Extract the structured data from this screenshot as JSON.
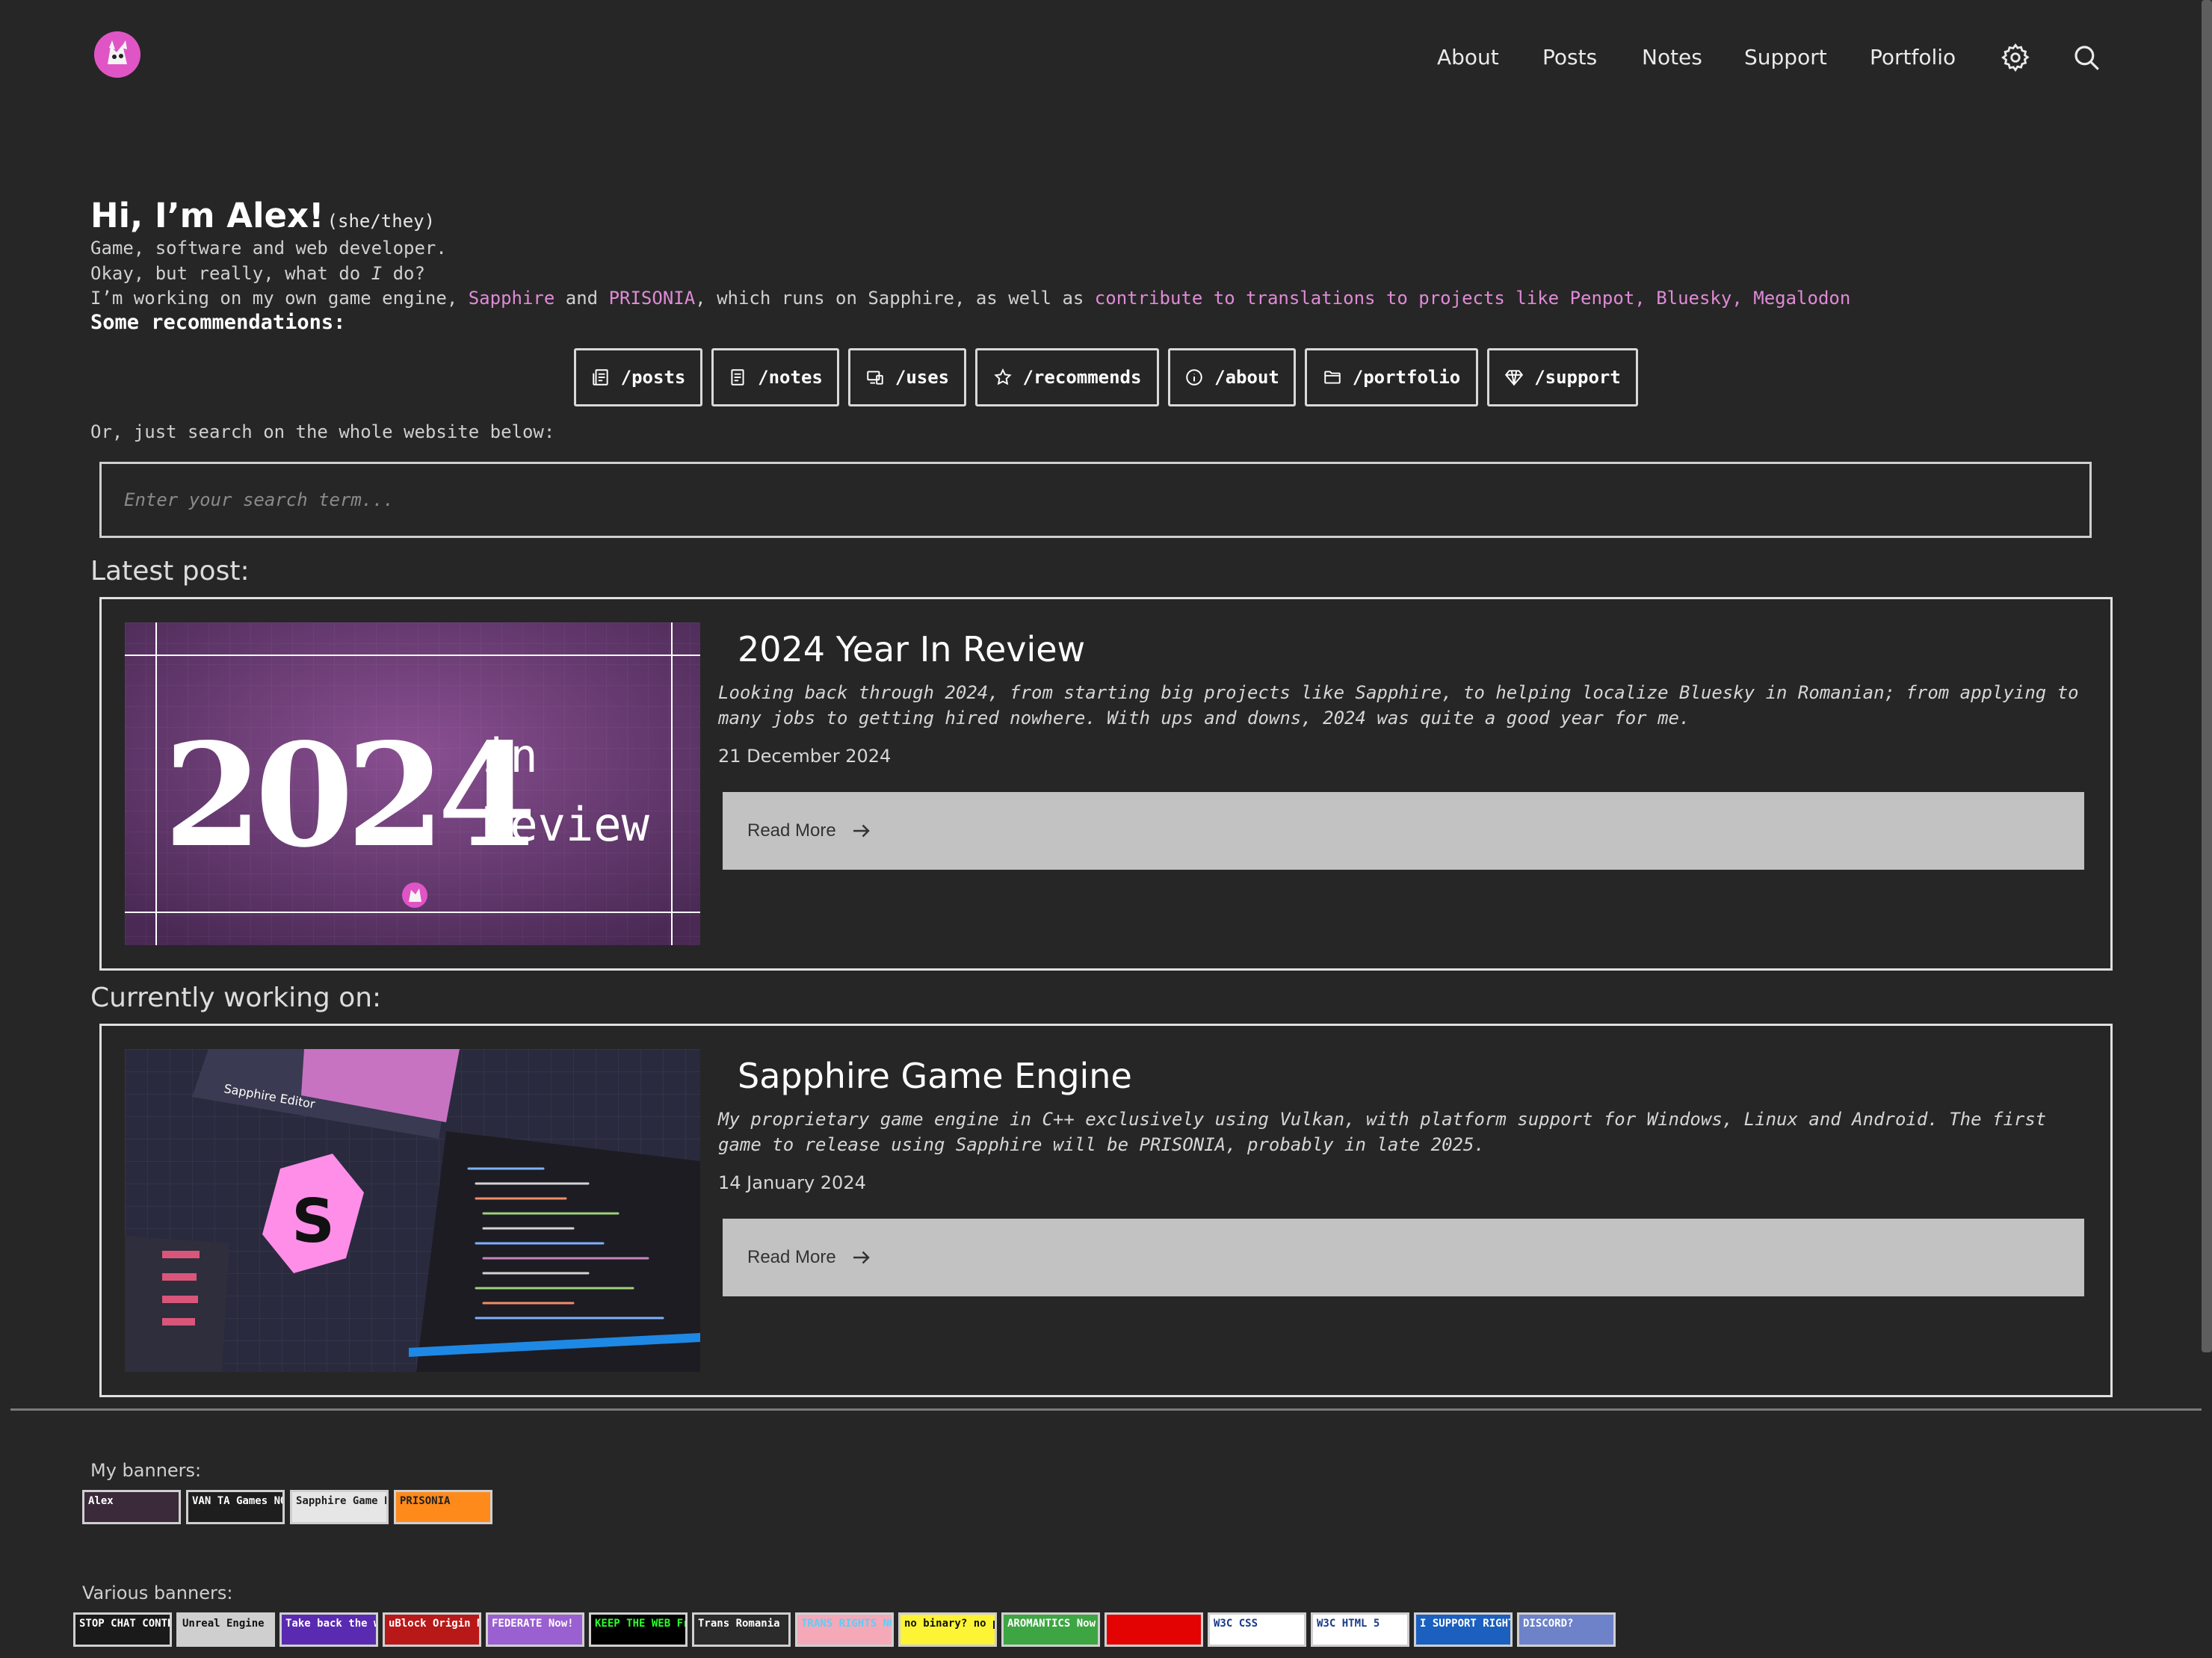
{
  "nav": {
    "links": [
      "About",
      "Posts",
      "Notes",
      "Support",
      "Portfolio"
    ],
    "settings_icon": "gear-icon",
    "search_icon": "search-icon"
  },
  "hero": {
    "greeting": "Hi, I’m Alex!",
    "pronouns": "(she/they)",
    "line1": "Game, software and web developer.",
    "line2_a": "Okay, but really, what do ",
    "line2_b": "I",
    "line2_c": " do?",
    "line3_a": "I’m working on my own game engine, ",
    "line3_sapphire": "Sapphire",
    "line3_and": " and ",
    "line3_prisonia": "PRISONIA",
    "line3_b": ", which runs on Sapphire, as well as ",
    "line3_contribute": "contribute to translations to projects like",
    "line3_penpot": "Penpot",
    "line3_bluesky": "Bluesky",
    "line3_megalodon": "Megalodon",
    "sep": ", ",
    "space": " ",
    "recommendations_label": "Some recommendations:"
  },
  "recommendations": [
    {
      "label": "/posts",
      "icon": "posts-icon"
    },
    {
      "label": "/notes",
      "icon": "notes-icon"
    },
    {
      "label": "/uses",
      "icon": "devices-icon"
    },
    {
      "label": "/recommends",
      "icon": "star-icon"
    },
    {
      "label": "/about",
      "icon": "info-icon"
    },
    {
      "label": "/portfolio",
      "icon": "folder-icon"
    },
    {
      "label": "/support",
      "icon": "diamond-icon"
    }
  ],
  "search": {
    "prompt": "Or, just search on the whole website below:",
    "placeholder": "Enter your search term..."
  },
  "latest_post": {
    "heading": "Latest post:",
    "title": "2024 Year In Review",
    "description": "Looking back through 2024, from starting big projects like Sapphire, to helping localize Bluesky in Romanian; from applying to many jobs to getting hired nowhere. With ups and downs, 2024 was quite a good year for me.",
    "date": "21 December 2024",
    "read_more": "Read More",
    "image_text_year": "2024",
    "image_text_in": "in",
    "image_text_review": "Review"
  },
  "current_project": {
    "heading": "Currently working on:",
    "title": "Sapphire Game Engine",
    "description": "My proprietary game engine in C++ exclusively using Vulkan, with platform support for Windows, Linux and Android. The first game to release using Sapphire will be PRISONIA, probably in late 2025.",
    "date": "14 January 2024",
    "read_more": "Read More",
    "image_editor_label": "Sapphire Editor",
    "image_logo_letter": "S"
  },
  "footer": {
    "my_banners_label": "My banners:",
    "my_banners": [
      {
        "text": "Alex",
        "bg": "#3a2a3a",
        "fg": "#ffffff"
      },
      {
        "text": "VAN TA  Games NOW!",
        "bg": "#1e1e1e",
        "fg": "#ffffff"
      },
      {
        "text": "Sapphire Game Engine",
        "bg": "#e6e6e6",
        "fg": "#222222"
      },
      {
        "text": "PRISONIA",
        "bg": "#ff8a1c",
        "fg": "#222222"
      }
    ],
    "various_banners_label": "Various banners:",
    "various_banners": [
      {
        "text": "STOP CHAT CONTROL",
        "bg": "#1a1a1a",
        "fg": "#ffffff"
      },
      {
        "text": "Unreal Engine",
        "bg": "#cfcfcf",
        "fg": "#111111"
      },
      {
        "text": "Take back the web",
        "bg": "#5a2bb0",
        "fg": "#ffffff"
      },
      {
        "text": "uBlock Origin Now!",
        "bg": "#b81818",
        "fg": "#ffffff"
      },
      {
        "text": "FEDERATE Now!",
        "bg": "#9a5fd0",
        "fg": "#ffffff"
      },
      {
        "text": "KEEP THE WEB Free",
        "bg": "#000000",
        "fg": "#2bff2b"
      },
      {
        "text": "Trans Romania",
        "bg": "#2b2b2b",
        "fg": "#ffffff"
      },
      {
        "text": "TRANS RIGHTS NOW!",
        "bg": "#f5a9b8",
        "fg": "#5bcefa"
      },
      {
        "text": "no binary? no problem!",
        "bg": "#fcf434",
        "fg": "#111111"
      },
      {
        "text": "AROMANTICS Now!",
        "bg": "#3da542",
        "fg": "#ffffff"
      },
      {
        "text": "",
        "bg": "#e40303",
        "fg": "#ffffff"
      },
      {
        "text": "W3C CSS",
        "bg": "#ffffff",
        "fg": "#1a3a8a"
      },
      {
        "text": "W3C HTML 5",
        "bg": "#ffffff",
        "fg": "#1a3a8a"
      },
      {
        "text": "I SUPPORT RIGHT TO REPAIR",
        "bg": "#1b5fbf",
        "fg": "#ffffff"
      },
      {
        "text": "DISCORD?",
        "bg": "#6d82c9",
        "fg": "#ffffff"
      }
    ]
  }
}
